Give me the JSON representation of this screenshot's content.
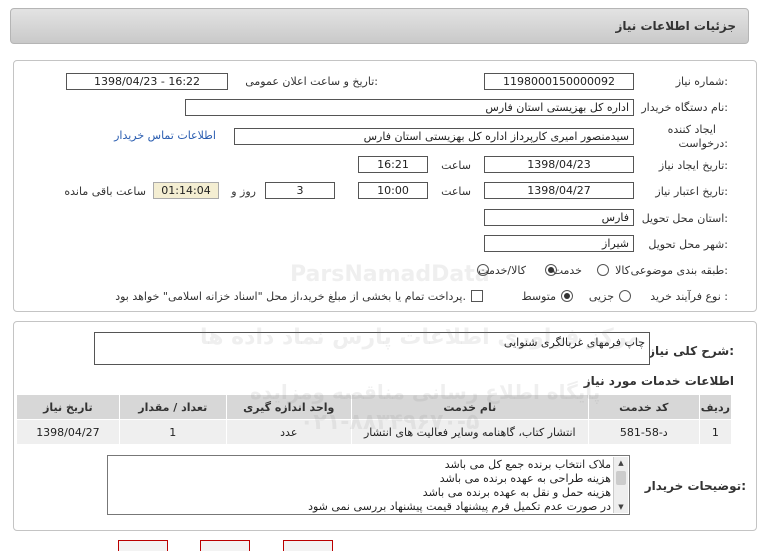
{
  "header": {
    "title": "جزئیات اطلاعات نیاز"
  },
  "info": {
    "need_number_label": "شماره نیاز:",
    "need_number": "1198000150000092",
    "announce_label": "تاریخ و ساعت اعلان عمومی:",
    "announce_value": "1398/04/23 - 16:22",
    "buyer_label": "نام دستگاه خریدار:",
    "buyer": "اداره کل بهزیستی استان فارس",
    "creator_label_1": "ایجاد کننده",
    "creator_label_2": "درخواست:",
    "creator": "سیدمنصور امیری کارپرداز اداره کل بهزیستی استان فارس",
    "contact_link": "اطلاعات تماس خریدار",
    "created_date_label": "تاریخ ایجاد نیاز:",
    "created_date": "1398/04/23",
    "time_label": "ساعت",
    "created_time": "16:21",
    "validity_label": "تاریخ اعتبار نیاز:",
    "validity_date": "1398/04/27",
    "validity_time": "10:00",
    "days": "3",
    "days_and": "روز و",
    "remaining": "01:14:04",
    "remaining_label": "ساعت باقی مانده",
    "province_label": "استان محل تحویل:",
    "province": "فارس",
    "city_label": "شهر محل تحویل:",
    "city": "شیراز",
    "category_label": "طبقه بندی موضوعی:",
    "category_options": [
      "کالا",
      "خدمت",
      "کالا/خدمت"
    ],
    "category_selected": "خدمت",
    "process_label": "نوع فرآیند خرید :",
    "process_options": [
      "جزیی",
      "متوسط"
    ],
    "process_selected": "متوسط",
    "payment_note": "پرداخت تمام یا بخشی از مبلغ خرید،از محل \"اسناد خزانه اسلامی\" خواهد بود."
  },
  "description": {
    "label": "شرح کلی نیاز:",
    "value": "چاپ فرمهای غربالگری شنوایی"
  },
  "services": {
    "title": "اطلاعات خدمات مورد نیاز",
    "columns": [
      "ردیف",
      "کد خدمت",
      "نام خدمت",
      "واحد اندازه گیری",
      "تعداد / مقدار",
      "تاریخ نیاز"
    ],
    "rows": [
      [
        "1",
        "د-58-581",
        "انتشار کتاب، گاهنامه وسایر فعالیت های انتشار",
        "عدد",
        "1",
        "1398/04/27"
      ]
    ]
  },
  "notes": {
    "label": "توضیحات خریدار:",
    "lines": [
      "ملاک انتخاب برنده جمع کل می باشد",
      "هزینه طراحی به عهده برنده می باشد",
      "هزینه حمل و نقل به عهده برنده می باشد",
      "در صورت عدم تکمیل فرم پیشنهاد قیمت پیشنهاد بررسی نمی شود"
    ]
  },
  "watermarks": [
    "ParsNamadData",
    "مرکز فراوری اطلاعات پارس نماد داده ها",
    "پایگاه اطلاع رسانی مناقصه ومزایده",
    "۰۲۱-۸۸۳۴۹۶۷۰-۵"
  ],
  "colors": {
    "link": "#2a5db0",
    "header_bg": "#d4d4d4",
    "table_header": "#d7d7d7"
  }
}
